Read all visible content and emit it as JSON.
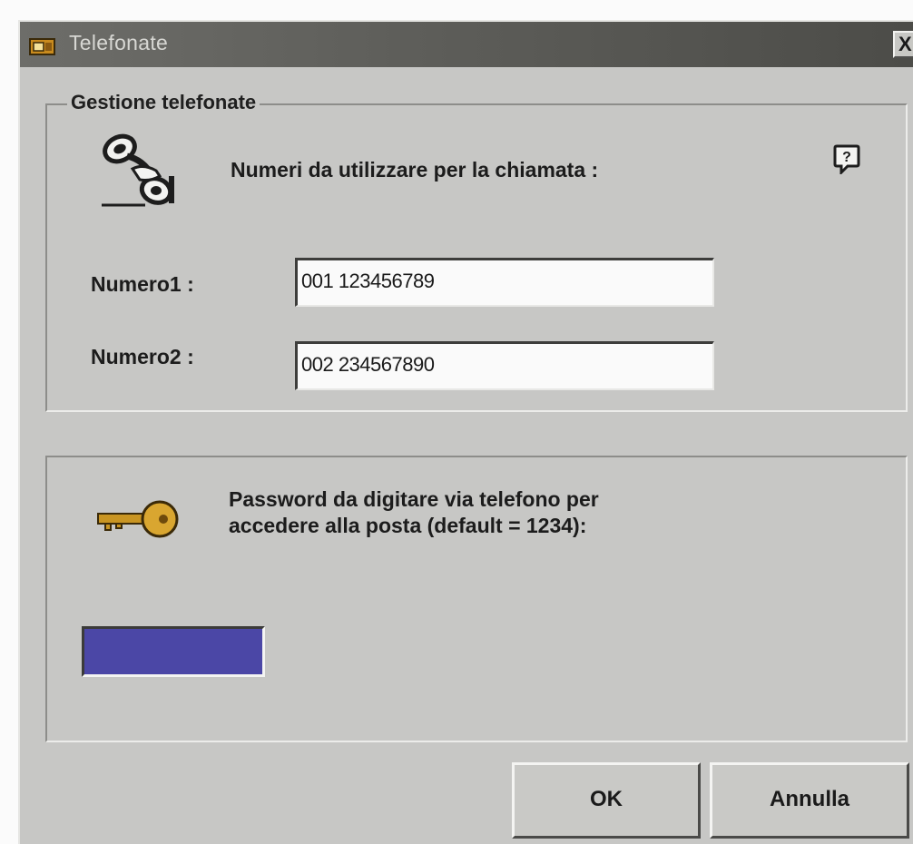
{
  "window": {
    "title": "Telefonate",
    "close_label": "X"
  },
  "group_calls": {
    "legend": "Gestione telefonate",
    "heading": "Numeri da utilizzare per la chiamata :",
    "help_label": "?",
    "numero1_label": "Numero1 :",
    "numero1_value": "001 123456789",
    "numero2_label": "Numero2 :",
    "numero2_value": "002 234567890"
  },
  "group_password": {
    "label_line1": "Password da digitare via telefono per",
    "label_line2": "accedere alla posta (default = 1234):",
    "field_color": "#4b47a6"
  },
  "buttons": {
    "ok_label": "OK",
    "cancel_label": "Annulla"
  },
  "icons": {
    "title": "phone-app-icon",
    "calls": "telephone-handset-icon",
    "help": "help-icon",
    "password": "key-icon"
  }
}
